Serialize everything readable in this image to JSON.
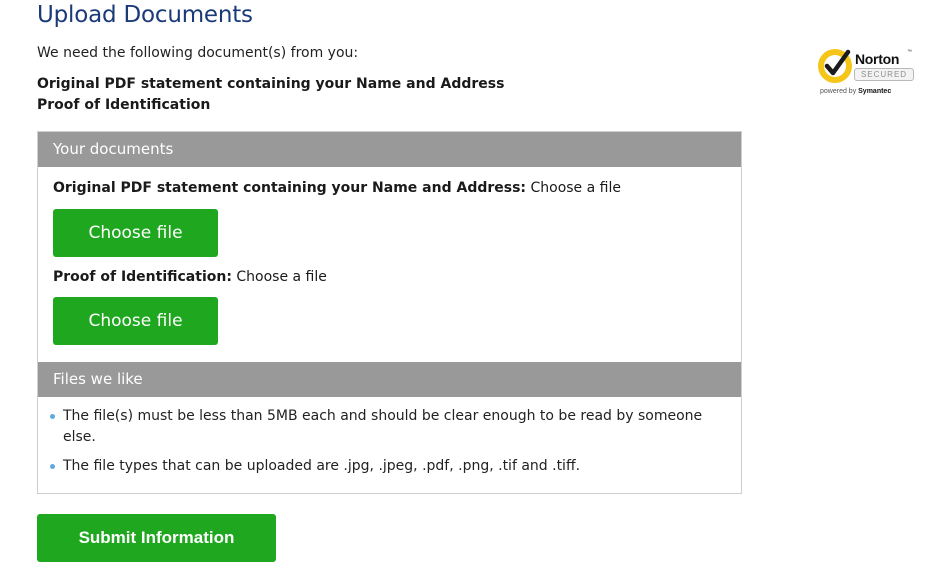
{
  "page": {
    "title": "Upload Documents",
    "intro": "We need the following document(s) from you:",
    "required_docs": [
      "Original PDF statement containing your Name and Address",
      "Proof of Identification"
    ]
  },
  "badge": {
    "brand": "Norton",
    "tm": "™",
    "secured": "SECURED",
    "powered_prefix": "powered by ",
    "powered_brand": "Symantec"
  },
  "panel": {
    "header": "Your documents",
    "documents": [
      {
        "label": "Original PDF statement containing your Name and Address:",
        "status": " Choose a file",
        "button": "Choose file"
      },
      {
        "label": "Proof of Identification:",
        "status": " Choose a file",
        "button": "Choose file"
      }
    ],
    "files_header": "Files we like",
    "rules": [
      "The file(s) must be less than 5MB each and should be clear enough to be read by someone else.",
      "The file types that can be uploaded are .jpg, .jpeg, .pdf, .png, .tif and .tiff."
    ]
  },
  "submit_label": "Submit Information",
  "colors": {
    "accent_green": "#1fa81f",
    "title_blue": "#1a3a78",
    "header_gray": "#999999",
    "bullet_blue": "#5da9e0",
    "norton_yellow": "#f5c518"
  }
}
